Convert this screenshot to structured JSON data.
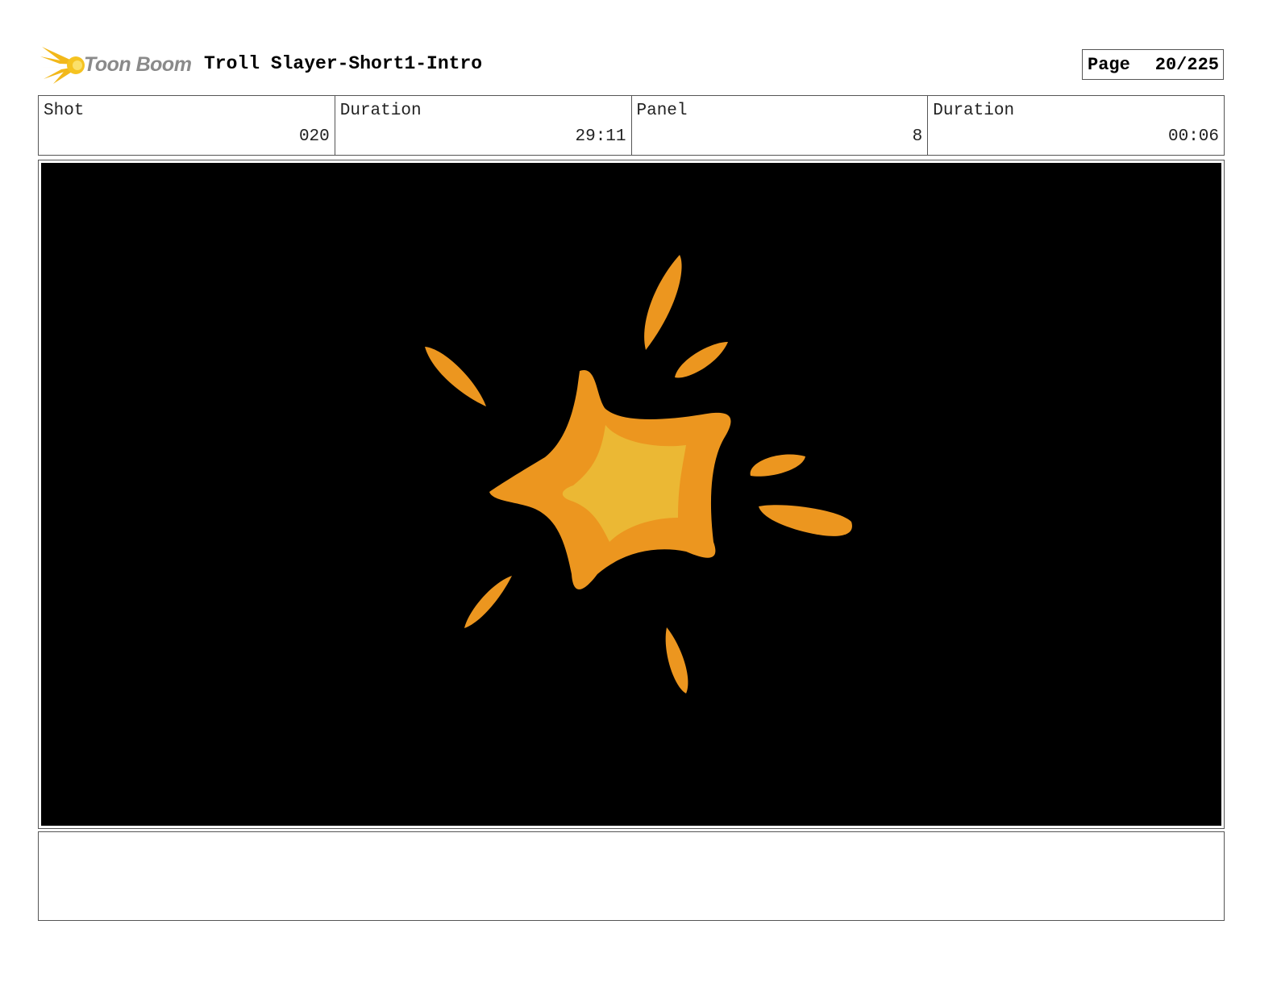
{
  "header": {
    "logo_text": "Toon Boom",
    "project_title": "Troll Slayer-Short1-Intro",
    "page_label": "Page",
    "page_value": "20/225"
  },
  "info": {
    "shot_label": "Shot",
    "shot_value": "020",
    "shot_duration_label": "Duration",
    "shot_duration_value": "29:11",
    "panel_label": "Panel",
    "panel_value": "8",
    "panel_duration_label": "Duration",
    "panel_duration_value": "00:06"
  },
  "panel": {
    "background": "#000000",
    "burst_outer_color": "#ec961f",
    "burst_inner_color": "#ebb834",
    "sparks_color": "#ec961f"
  },
  "notes": {
    "text": ""
  }
}
